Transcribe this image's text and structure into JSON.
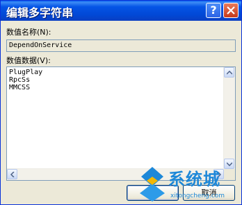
{
  "window": {
    "title": "编辑多字符串",
    "help_glyph": "?",
    "close_icon": "close-icon"
  },
  "value_name": {
    "label": "数值名称(N):",
    "value": "DependOnService"
  },
  "value_data": {
    "label": "数值数据(V):",
    "lines": [
      "PlugPlay",
      "RpcSs",
      "MMCSS"
    ]
  },
  "buttons": {
    "ok": "确定",
    "cancel": "取消"
  },
  "watermark": {
    "brand": "系统城",
    "url": "xitongcheng.com",
    "color": "#1e88d8"
  },
  "colors": {
    "titlebar": "#0148d6",
    "dialog_bg": "#ece9d8"
  }
}
